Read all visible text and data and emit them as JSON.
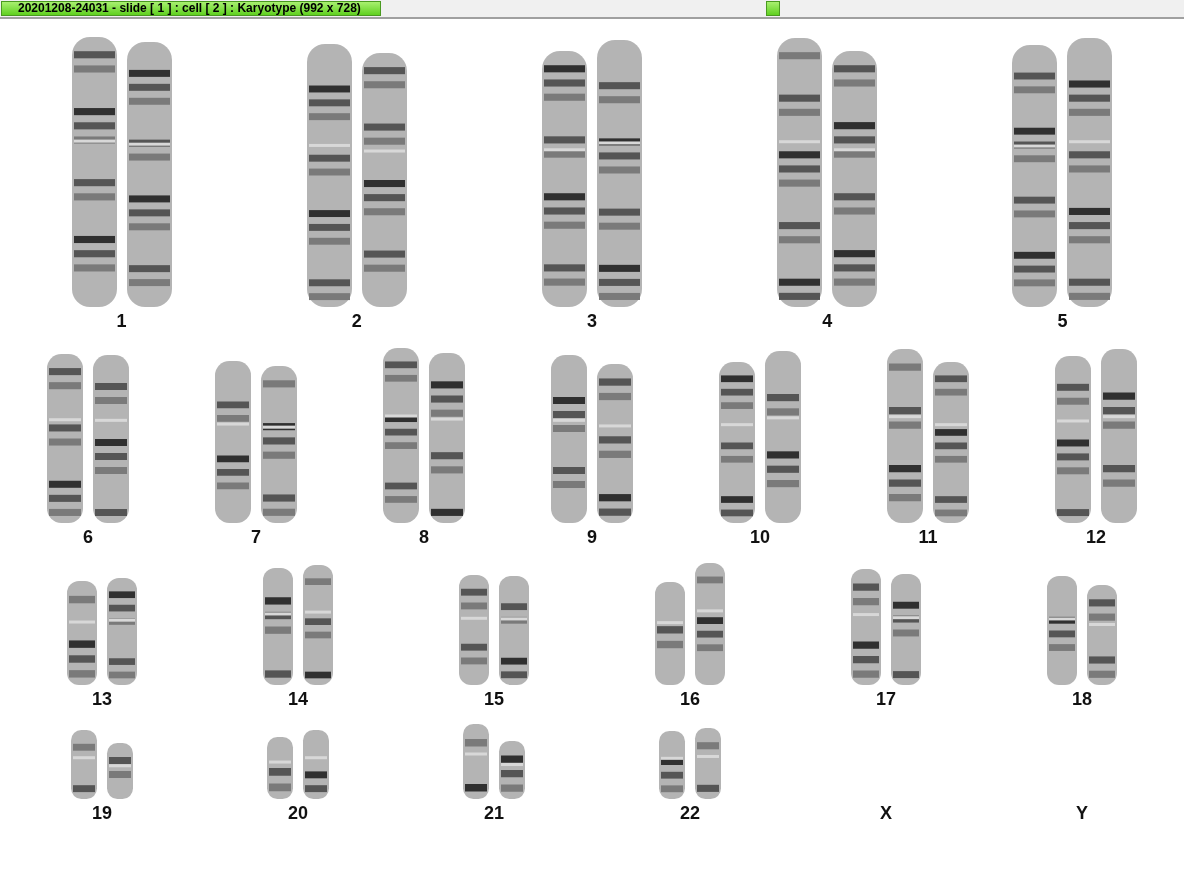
{
  "window": {
    "title": "20201208-24031 - slide [ 1 ] : cell [ 2 ] : Karyotype  (992 x 728)"
  },
  "karyotype": {
    "rows": [
      [
        {
          "label": "1",
          "kind": "pair"
        },
        {
          "label": "2",
          "kind": "pair"
        },
        {
          "label": "3",
          "kind": "pair"
        },
        {
          "label": "4",
          "kind": "pair"
        },
        {
          "label": "5",
          "kind": "pair"
        }
      ],
      [
        {
          "label": "6",
          "kind": "pair"
        },
        {
          "label": "7",
          "kind": "pair"
        },
        {
          "label": "8",
          "kind": "pair"
        },
        {
          "label": "9",
          "kind": "pair"
        },
        {
          "label": "10",
          "kind": "pair"
        },
        {
          "label": "11",
          "kind": "pair"
        },
        {
          "label": "12",
          "kind": "pair"
        }
      ],
      [
        {
          "label": "13",
          "kind": "pair"
        },
        {
          "label": "14",
          "kind": "pair"
        },
        {
          "label": "15",
          "kind": "pair"
        },
        {
          "label": "16",
          "kind": "pair"
        },
        {
          "label": "17",
          "kind": "pair"
        },
        {
          "label": "18",
          "kind": "pair"
        }
      ],
      [
        {
          "label": "19",
          "kind": "pair"
        },
        {
          "label": "20",
          "kind": "pair"
        },
        {
          "label": "21",
          "kind": "pair"
        },
        {
          "label": "22",
          "kind": "pair"
        },
        {
          "label": "X",
          "kind": "empty"
        },
        {
          "label": "Y",
          "kind": "empty"
        }
      ]
    ]
  }
}
